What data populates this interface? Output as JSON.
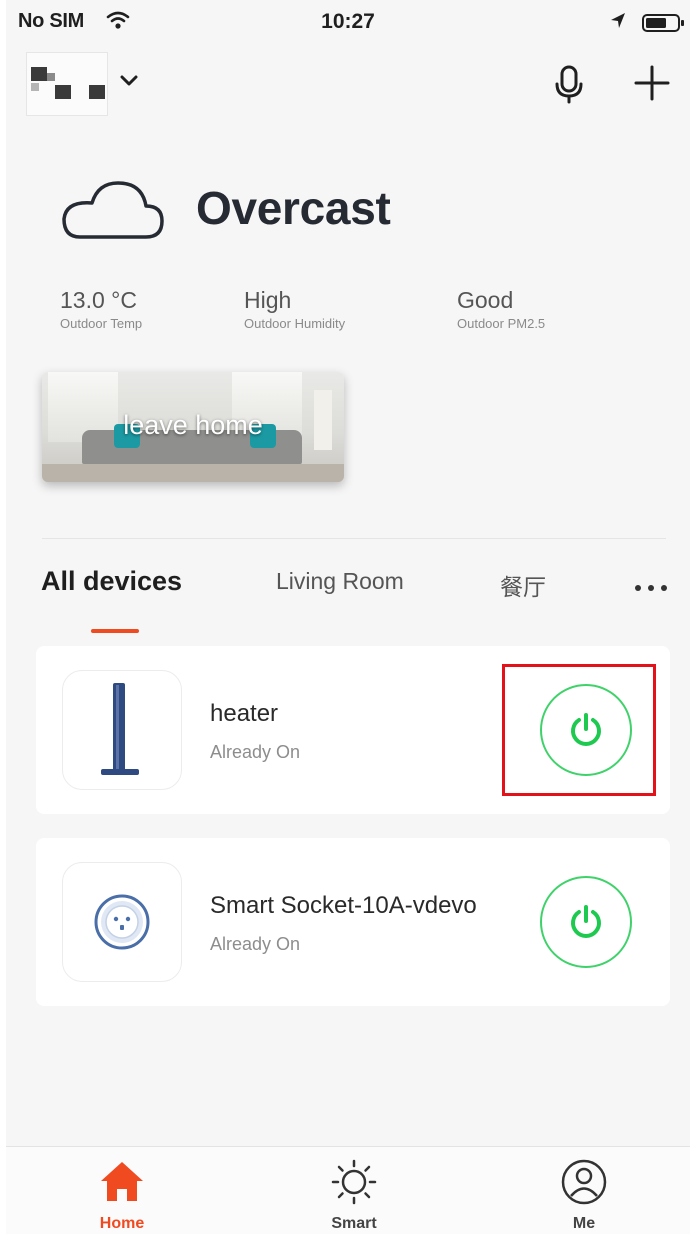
{
  "status_bar": {
    "carrier": "No SIM",
    "time": "10:27"
  },
  "header": {
    "home_switcher_icon": "qr-code-icon",
    "voice_icon": "microphone-icon",
    "add_icon": "plus-icon"
  },
  "weather": {
    "condition": "Overcast",
    "icon": "cloud-icon",
    "stats": [
      {
        "value": "13.0 °C",
        "label": "Outdoor Temp"
      },
      {
        "value": "High",
        "label": "Outdoor Humidity"
      },
      {
        "value": "Good",
        "label": "Outdoor PM2.5"
      }
    ]
  },
  "scene": {
    "label": "leave home"
  },
  "tabs": {
    "items": [
      "All devices",
      "Living Room",
      "餐厅"
    ],
    "active": "All devices",
    "more_icon": "more-dots-icon"
  },
  "devices": [
    {
      "name": "heater",
      "status": "Already On",
      "icon": "heater-icon",
      "power_icon": "power-icon"
    },
    {
      "name": "Smart Socket-10A-vdevo",
      "status": "Already On",
      "icon": "socket-icon",
      "power_icon": "power-icon"
    }
  ],
  "tabbar": {
    "items": [
      {
        "label": "Home",
        "icon": "home-icon"
      },
      {
        "label": "Smart",
        "icon": "sun-icon"
      },
      {
        "label": "Me",
        "icon": "user-icon"
      }
    ],
    "active": "Home"
  },
  "colors": {
    "accent": "#f04a20",
    "power_on": "#1ec94f",
    "highlight": "#e3121a",
    "background": "#f6f6f6"
  }
}
